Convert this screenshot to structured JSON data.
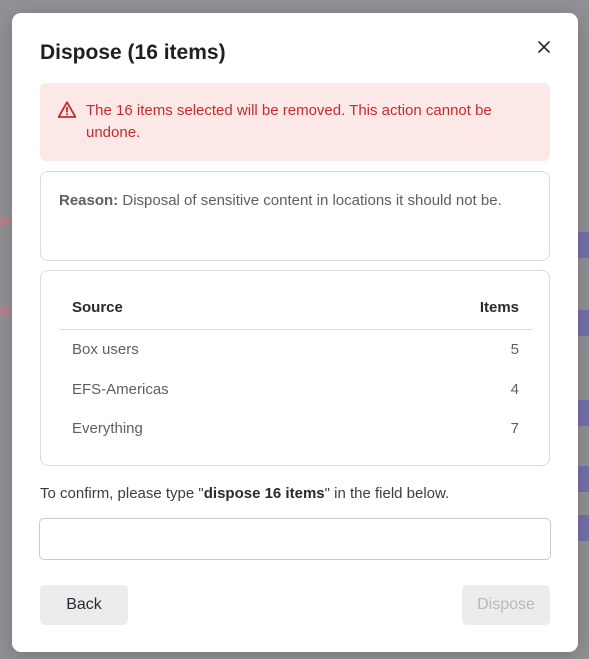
{
  "modal": {
    "title": "Dispose (16 items)"
  },
  "alert": {
    "icon": "warning-triangle-icon",
    "color": "#c62b2b",
    "background": "#fde8e8",
    "text": "The 16 items selected will be removed. This action cannot be undone."
  },
  "reason": {
    "label": "Reason:",
    "text": "Disposal of sensitive content in locations it should not be."
  },
  "table": {
    "headers": {
      "source": "Source",
      "items": "Items"
    },
    "rows": [
      {
        "source": "Box users",
        "items": "5"
      },
      {
        "source": "EFS-Americas",
        "items": "4"
      },
      {
        "source": "Everything",
        "items": "7"
      }
    ]
  },
  "confirm": {
    "prefix": "To confirm, please type \"",
    "phrase": "dispose 16 items",
    "suffix": "\" in the field below.",
    "value": "",
    "placeholder": ""
  },
  "buttons": {
    "back": "Back",
    "dispose": "Dispose",
    "dispose_disabled": true
  }
}
